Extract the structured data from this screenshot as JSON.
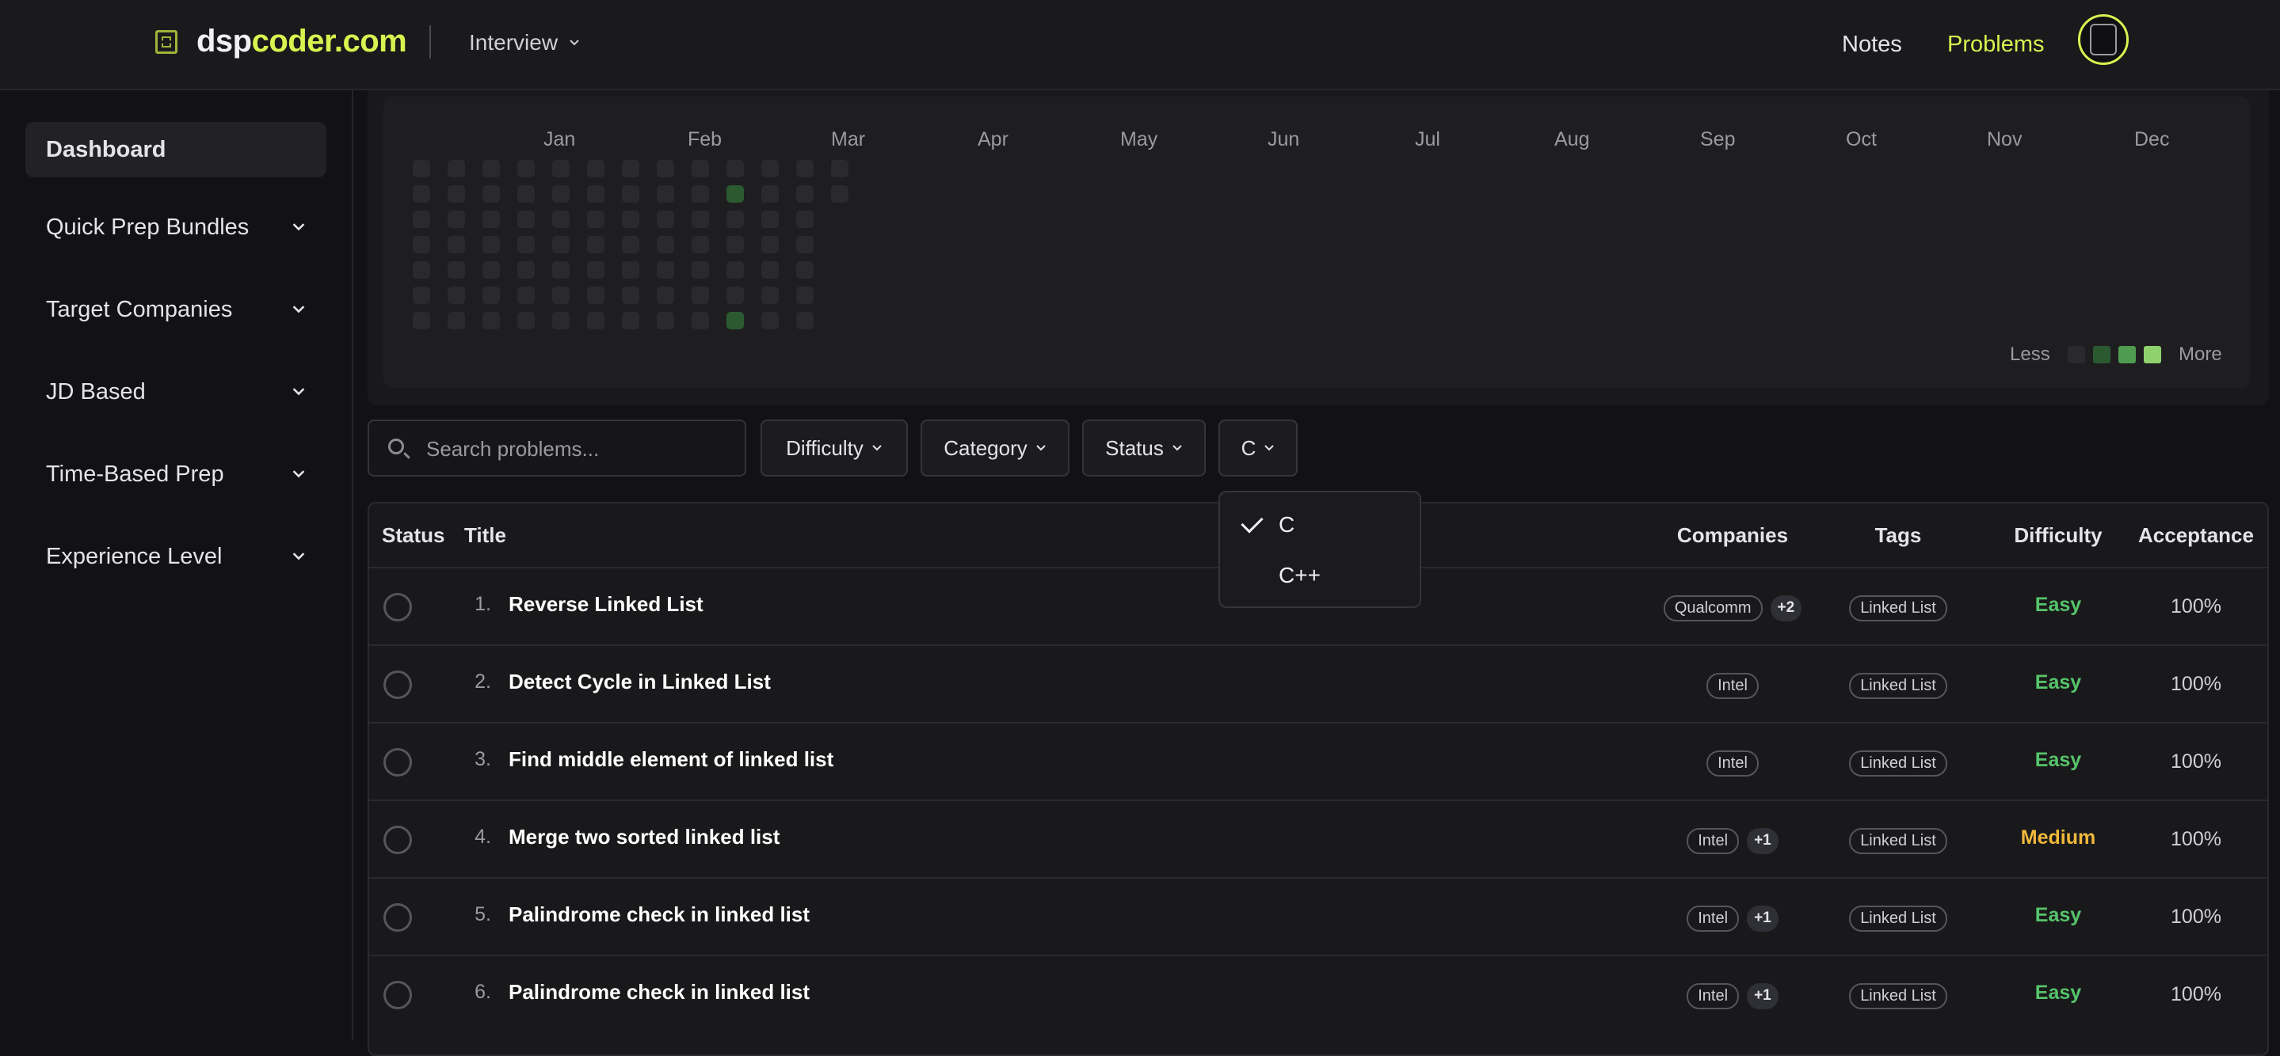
{
  "header": {
    "logo_text_a": "dsp",
    "logo_text_b": "coder.com",
    "interview_label": "Interview",
    "nav": {
      "notes": "Notes",
      "problems": "Problems"
    },
    "brand_color": "#d9f24f"
  },
  "sidebar": {
    "items": [
      {
        "label": "Dashboard",
        "active": true
      },
      {
        "label": "Quick Prep Bundles"
      },
      {
        "label": "Target Companies"
      },
      {
        "label": "JD Based"
      },
      {
        "label": "Time-Based Prep"
      },
      {
        "label": "Experience Level"
      }
    ]
  },
  "heatmap": {
    "months": [
      "Jan",
      "Feb",
      "Mar",
      "Apr",
      "May",
      "Jun",
      "Jul",
      "Aug",
      "Sep",
      "Oct",
      "Nov",
      "Dec"
    ],
    "legend_less": "Less",
    "legend_more": "More",
    "legend_colors": [
      "#2a2a2d",
      "#2b5a31",
      "#4f9c50",
      "#8fd26d"
    ]
  },
  "filters": {
    "search_placeholder": "Search problems...",
    "difficulty": "Difficulty",
    "category": "Category",
    "status": "Status",
    "language": "C"
  },
  "language_dropdown": {
    "options": [
      {
        "label": "C",
        "selected": true
      },
      {
        "label": "C++",
        "selected": false
      }
    ]
  },
  "table": {
    "headers": {
      "status": "Status",
      "title": "Title",
      "companies": "Companies",
      "tags": "Tags",
      "difficulty": "Difficulty",
      "acceptance": "Acceptance"
    },
    "rows": [
      {
        "num": "1.",
        "title": "Reverse Linked List",
        "company": "Qualcomm",
        "more": "+2",
        "tag": "Linked List",
        "difficulty": "Easy",
        "acceptance": "100%"
      },
      {
        "num": "2.",
        "title": "Detect Cycle in Linked List",
        "company": "Intel",
        "more": "",
        "tag": "Linked List",
        "difficulty": "Easy",
        "acceptance": "100%"
      },
      {
        "num": "3.",
        "title": "Find middle element of linked list",
        "company": "Intel",
        "more": "",
        "tag": "Linked List",
        "difficulty": "Easy",
        "acceptance": "100%"
      },
      {
        "num": "4.",
        "title": "Merge two sorted linked list",
        "company": "Intel",
        "more": "+1",
        "tag": "Linked List",
        "difficulty": "Medium",
        "acceptance": "100%"
      },
      {
        "num": "5.",
        "title": "Palindrome check in linked list",
        "company": "Intel",
        "more": "+1",
        "tag": "Linked List",
        "difficulty": "Easy",
        "acceptance": "100%"
      },
      {
        "num": "6.",
        "title": "Palindrome check in linked list",
        "company": "Intel",
        "more": "+1",
        "tag": "Linked List",
        "difficulty": "Easy",
        "acceptance": "100%"
      }
    ]
  }
}
